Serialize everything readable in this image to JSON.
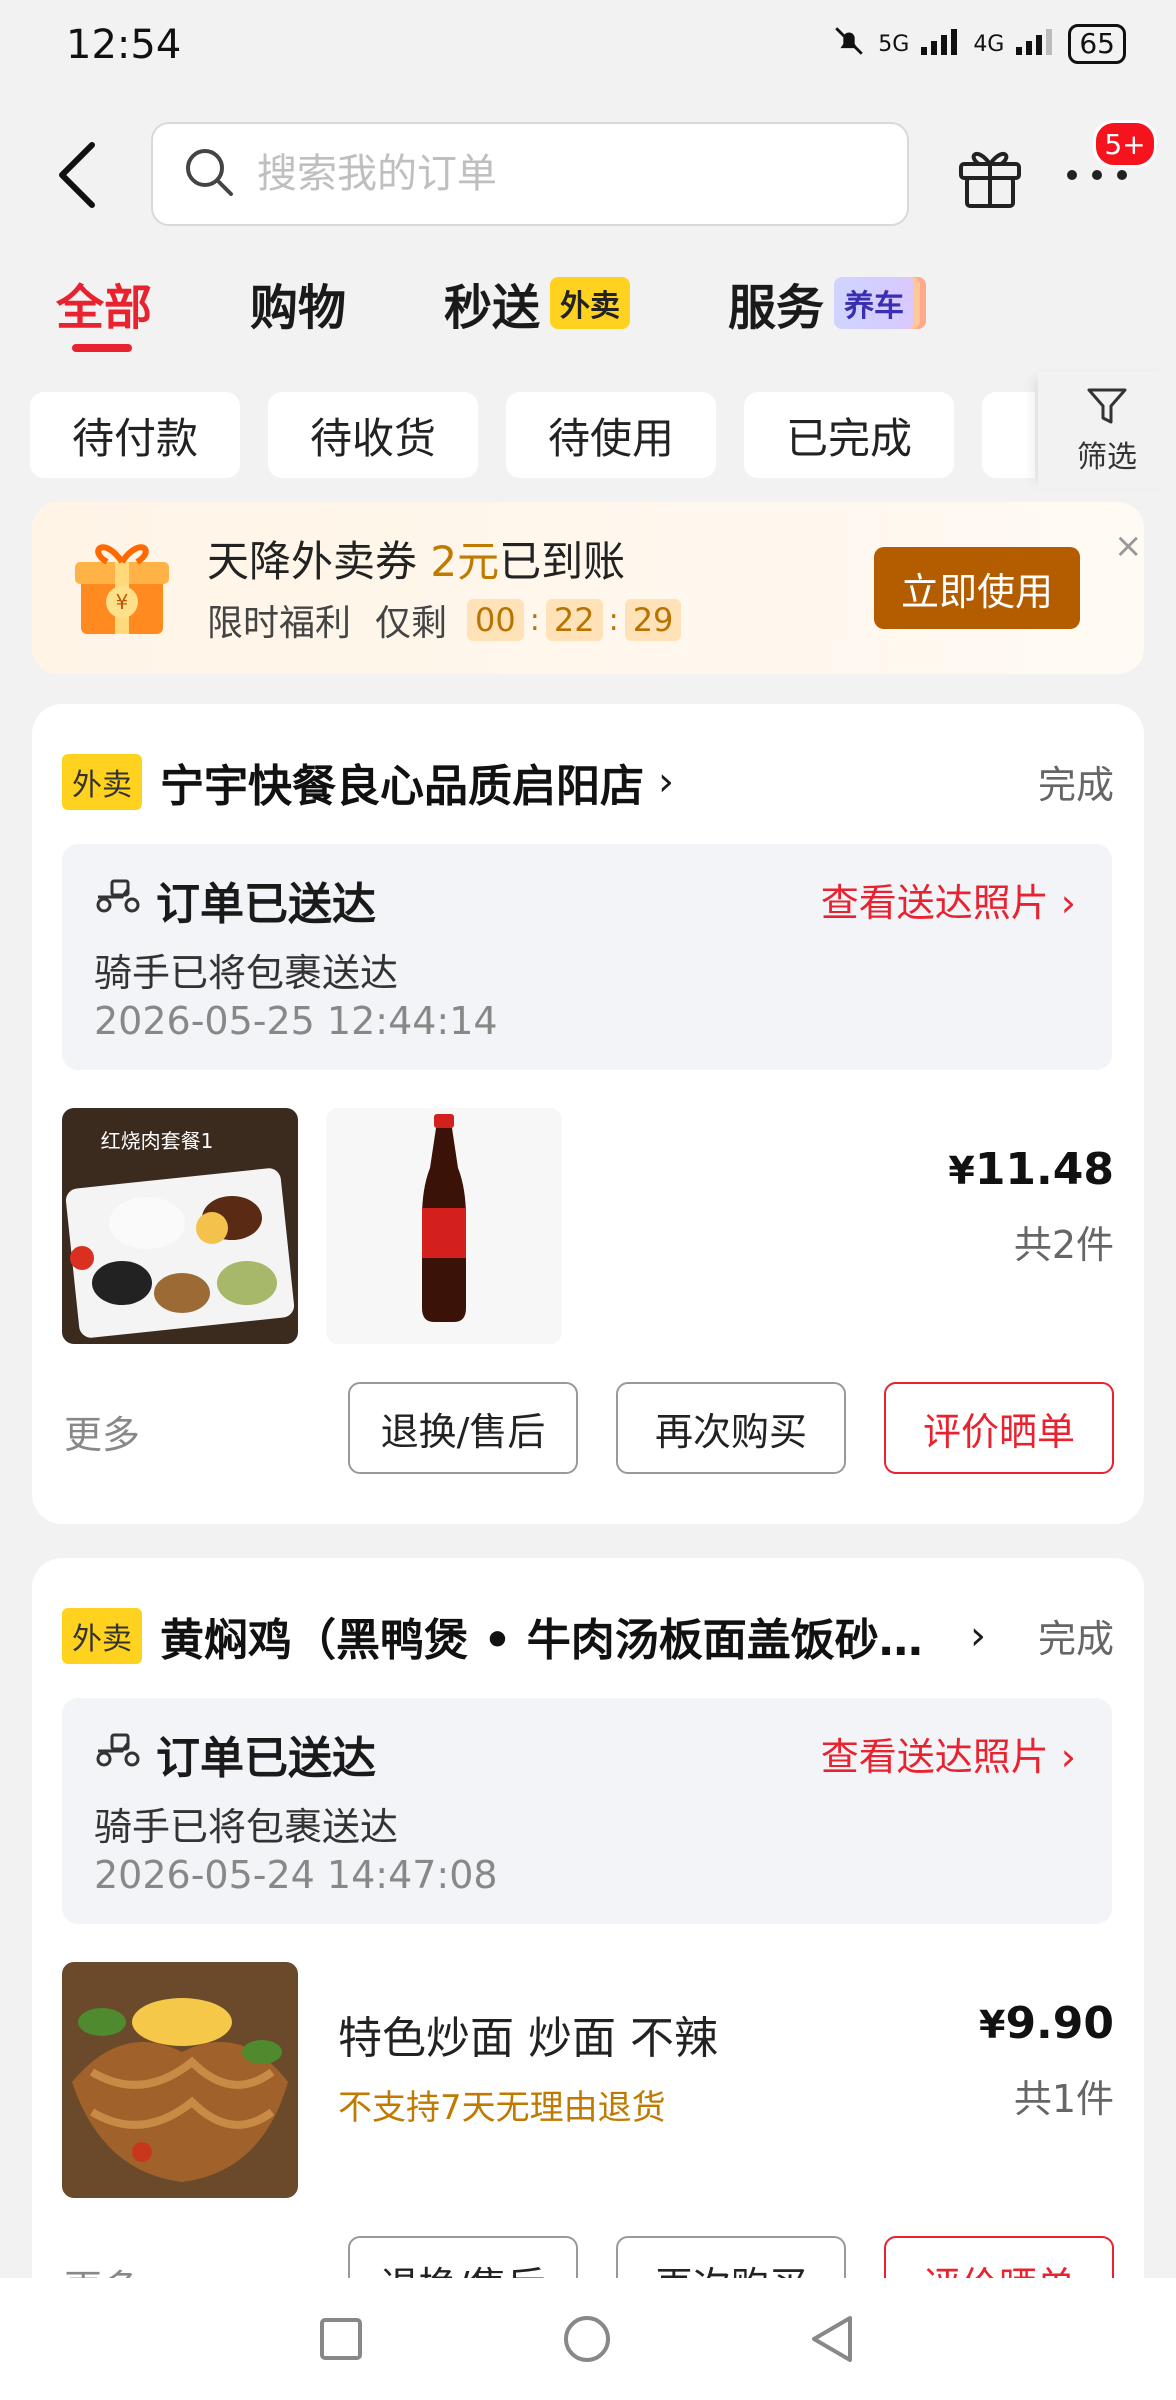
{
  "status_bar": {
    "time": "12:54",
    "signal_a": "5G",
    "signal_b": "4G",
    "battery": "65"
  },
  "header": {
    "search_placeholder": "搜索我的订单",
    "notification_badge": "5+"
  },
  "tabs": [
    {
      "label": "全部",
      "active": true
    },
    {
      "label": "购物"
    },
    {
      "label": "秒送",
      "pill": "外卖"
    },
    {
      "label": "服务",
      "pill": "养车"
    }
  ],
  "filters": {
    "chips": [
      "待付款",
      "待收货",
      "待使用",
      "已完成",
      "待"
    ],
    "filter_label": "筛选"
  },
  "promo": {
    "title_prefix": "天降外卖券 ",
    "amount": "2元",
    "title_suffix": "已到账",
    "sub_label": "限时福利",
    "remaining_label": "仅剩",
    "countdown": [
      "00",
      "22",
      "29"
    ],
    "button": "立即使用",
    "close": "×"
  },
  "orders": [
    {
      "tag": "外卖",
      "store": "宁宇快餐良心品质启阳店",
      "status": "完成",
      "delivery_title": "订单已送达",
      "delivery_photo": "查看送达照片",
      "delivery_sub": "骑手已将包裹送达",
      "delivery_time": "2026-05-25 12:44:14",
      "thumb1_caption": "红烧肉套餐1",
      "price_symbol": "¥",
      "price": "11.48",
      "count": "共2件",
      "more": "更多",
      "buttons": [
        "退换/售后",
        "再次购买",
        "评价晒单"
      ]
    },
    {
      "tag": "外卖",
      "store": "黄焖鸡（黑鸭煲 • 牛肉汤板面盖饭砂…",
      "status": "完成",
      "delivery_title": "订单已送达",
      "delivery_photo": "查看送达照片",
      "delivery_sub": "骑手已将包裹送达",
      "delivery_time": "2026-05-24 14:47:08",
      "item_name": "特色炒面 炒面 不辣",
      "item_note": "不支持7天无理由退货",
      "price_symbol": "¥",
      "price": "9.90",
      "count": "共1件",
      "more": "更多",
      "buttons": [
        "退换/售后",
        "再次购买",
        "评价晒单"
      ]
    }
  ],
  "colors": {
    "accent": "#e8232f",
    "takeout_tag": "#ffd21f",
    "promo_button": "#b45d00"
  }
}
